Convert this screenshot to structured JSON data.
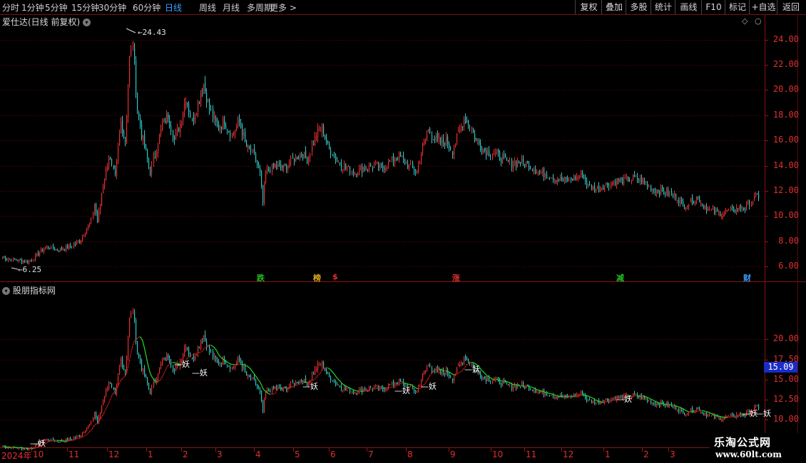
{
  "periods": [
    "分时",
    "1分钟",
    "5分钟",
    "15分钟",
    "30分钟",
    "60分钟",
    "日线",
    "周线",
    "月线",
    "多周期",
    "更多 >"
  ],
  "active_period": "日线",
  "right_buttons": [
    "复权",
    "叠加",
    "多股",
    "统计",
    "画线",
    "F10",
    "标记",
    "+自选",
    "返回"
  ],
  "main_title": "爱仕达(日线 前复权)",
  "sub_title": "股朋指标网",
  "main_axis": [
    "24.00",
    "22.00",
    "20.00",
    "18.00",
    "16.00",
    "14.00",
    "12.00",
    "10.00",
    "8.00",
    "6.00"
  ],
  "sub_axis": [
    "20.00",
    "17.50",
    "15.00",
    "12.50",
    "10.00"
  ],
  "current_value": "15.09",
  "high_label": "24.43",
  "low_label": "6.25",
  "events": [
    {
      "text": "跌",
      "color": "#20c020"
    },
    {
      "text": "榜",
      "color": "#e0b020"
    },
    {
      "text": "$",
      "color": "#e03030"
    },
    {
      "text": "涨",
      "color": "#e03030"
    },
    {
      "text": "减",
      "color": "#20c020"
    },
    {
      "text": "财",
      "color": "#3aa0ff"
    }
  ],
  "x_axis": [
    "2024年",
    "10",
    "11",
    "12",
    "1",
    "2",
    "3",
    "4",
    "5",
    "6",
    "7",
    "8",
    "9",
    "10",
    "11",
    "12",
    "1",
    "2",
    "3"
  ],
  "signal_label": "妖",
  "watermark": {
    "name": "乐淘公式网",
    "url": "www.60lt.com"
  },
  "colors": {
    "up": "#e83030",
    "down": "#30c8c8",
    "ma_up": "#e02020",
    "ma_down": "#20d020",
    "axis": "#8a1010"
  },
  "chart_data": {
    "type": "candlestick",
    "title": "爱仕达(日线 前复权)",
    "ylim": [
      5.5,
      25
    ],
    "sub_ylim": [
      8,
      25
    ],
    "max": 24.43,
    "min": 6.25,
    "x_months": [
      "2024年",
      "10",
      "11",
      "12",
      "1",
      "2",
      "3",
      "4",
      "5",
      "6",
      "7",
      "8",
      "9",
      "10",
      "11",
      "12",
      "1",
      "2",
      "3"
    ],
    "close_path": [
      {
        "d": 0,
        "v": 6.7
      },
      {
        "d": 10,
        "v": 6.5
      },
      {
        "d": 18,
        "v": 6.4
      },
      {
        "d": 24,
        "v": 7.0
      },
      {
        "d": 30,
        "v": 7.6
      },
      {
        "d": 38,
        "v": 7.3
      },
      {
        "d": 46,
        "v": 7.6
      },
      {
        "d": 52,
        "v": 8.0
      },
      {
        "d": 56,
        "v": 8.8
      },
      {
        "d": 60,
        "v": 9.6
      },
      {
        "d": 62,
        "v": 11.0
      },
      {
        "d": 64,
        "v": 9.5
      },
      {
        "d": 68,
        "v": 12.5
      },
      {
        "d": 72,
        "v": 14.8
      },
      {
        "d": 76,
        "v": 13.0
      },
      {
        "d": 80,
        "v": 17.5
      },
      {
        "d": 83,
        "v": 16.0
      },
      {
        "d": 86,
        "v": 22.5
      },
      {
        "d": 88,
        "v": 23.8
      },
      {
        "d": 91,
        "v": 18.5
      },
      {
        "d": 94,
        "v": 16.5
      },
      {
        "d": 97,
        "v": 15.0
      },
      {
        "d": 100,
        "v": 13.5
      },
      {
        "d": 104,
        "v": 15.5
      },
      {
        "d": 108,
        "v": 17.2
      },
      {
        "d": 112,
        "v": 18.0
      },
      {
        "d": 116,
        "v": 16.0
      },
      {
        "d": 120,
        "v": 17.3
      },
      {
        "d": 124,
        "v": 19.5
      },
      {
        "d": 128,
        "v": 17.5
      },
      {
        "d": 132,
        "v": 19.0
      },
      {
        "d": 136,
        "v": 20.5
      },
      {
        "d": 140,
        "v": 18.5
      },
      {
        "d": 145,
        "v": 17.0
      },
      {
        "d": 150,
        "v": 17.5
      },
      {
        "d": 155,
        "v": 16.5
      },
      {
        "d": 160,
        "v": 17.5
      },
      {
        "d": 165,
        "v": 15.5
      },
      {
        "d": 170,
        "v": 14.8
      },
      {
        "d": 174,
        "v": 13.3
      },
      {
        "d": 176,
        "v": 11.0
      },
      {
        "d": 178,
        "v": 13.5
      },
      {
        "d": 184,
        "v": 14.0
      },
      {
        "d": 190,
        "v": 13.8
      },
      {
        "d": 196,
        "v": 14.5
      },
      {
        "d": 202,
        "v": 15.0
      },
      {
        "d": 206,
        "v": 14.5
      },
      {
        "d": 212,
        "v": 16.5
      },
      {
        "d": 216,
        "v": 17.0
      },
      {
        "d": 220,
        "v": 15.5
      },
      {
        "d": 226,
        "v": 14.5
      },
      {
        "d": 232,
        "v": 13.8
      },
      {
        "d": 238,
        "v": 13.5
      },
      {
        "d": 244,
        "v": 13.8
      },
      {
        "d": 250,
        "v": 14.0
      },
      {
        "d": 256,
        "v": 13.8
      },
      {
        "d": 262,
        "v": 14.3
      },
      {
        "d": 268,
        "v": 14.8
      },
      {
        "d": 274,
        "v": 14.0
      },
      {
        "d": 280,
        "v": 13.5
      },
      {
        "d": 284,
        "v": 15.5
      },
      {
        "d": 288,
        "v": 16.8
      },
      {
        "d": 292,
        "v": 16.2
      },
      {
        "d": 296,
        "v": 15.8
      },
      {
        "d": 300,
        "v": 16.0
      },
      {
        "d": 304,
        "v": 15.2
      },
      {
        "d": 308,
        "v": 16.5
      },
      {
        "d": 312,
        "v": 17.8
      },
      {
        "d": 316,
        "v": 17.2
      },
      {
        "d": 320,
        "v": 16.0
      },
      {
        "d": 326,
        "v": 15.2
      },
      {
        "d": 332,
        "v": 15.0
      },
      {
        "d": 338,
        "v": 14.5
      },
      {
        "d": 344,
        "v": 14.2
      },
      {
        "d": 350,
        "v": 14.3
      },
      {
        "d": 356,
        "v": 14.0
      },
      {
        "d": 362,
        "v": 13.5
      },
      {
        "d": 368,
        "v": 13.3
      },
      {
        "d": 374,
        "v": 13.0
      },
      {
        "d": 380,
        "v": 12.8
      },
      {
        "d": 386,
        "v": 13.0
      },
      {
        "d": 392,
        "v": 13.3
      },
      {
        "d": 396,
        "v": 12.3
      },
      {
        "d": 402,
        "v": 12.2
      },
      {
        "d": 408,
        "v": 12.5
      },
      {
        "d": 414,
        "v": 12.8
      },
      {
        "d": 420,
        "v": 12.8
      },
      {
        "d": 426,
        "v": 13.0
      },
      {
        "d": 432,
        "v": 12.8
      },
      {
        "d": 438,
        "v": 12.2
      },
      {
        "d": 444,
        "v": 12.0
      },
      {
        "d": 450,
        "v": 11.8
      },
      {
        "d": 456,
        "v": 11.5
      },
      {
        "d": 460,
        "v": 10.8
      },
      {
        "d": 466,
        "v": 11.2
      },
      {
        "d": 470,
        "v": 11.5
      },
      {
        "d": 474,
        "v": 10.8
      },
      {
        "d": 478,
        "v": 10.5
      },
      {
        "d": 482,
        "v": 10.3
      },
      {
        "d": 486,
        "v": 10.2
      },
      {
        "d": 490,
        "v": 10.4
      },
      {
        "d": 494,
        "v": 10.5
      },
      {
        "d": 498,
        "v": 10.7
      },
      {
        "d": 502,
        "v": 10.6
      },
      {
        "d": 506,
        "v": 11.2
      },
      {
        "d": 510,
        "v": 11.6
      }
    ]
  }
}
